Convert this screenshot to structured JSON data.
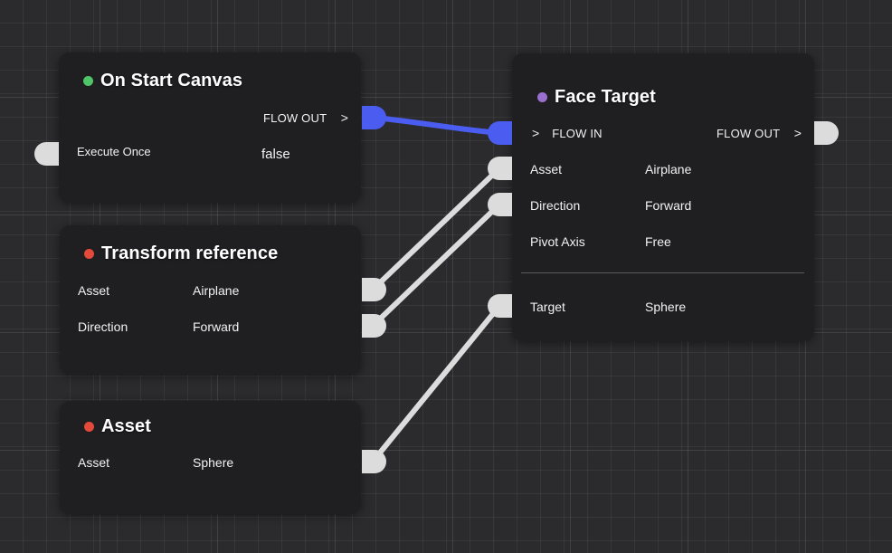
{
  "theme": {
    "background": "#2b2b2e",
    "node_background": "#1f1f22",
    "flow_wire_color": "#4a5df0",
    "data_wire_color": "#dcdcdc",
    "status_green": "#4fc56a",
    "status_red": "#e5493a",
    "status_purple": "#9b6fce"
  },
  "nodes": {
    "on_start_canvas": {
      "title": "On Start Canvas",
      "flow_out_label": "FLOW OUT",
      "chevron": ">",
      "execute_once_label": "Execute Once",
      "execute_once_value": "false"
    },
    "transform_reference": {
      "title": "Transform reference",
      "rows": [
        {
          "label": "Asset",
          "value": "Airplane"
        },
        {
          "label": "Direction",
          "value": "Forward"
        }
      ]
    },
    "asset": {
      "title": "Asset",
      "rows": [
        {
          "label": "Asset",
          "value": "Sphere"
        }
      ]
    },
    "face_target": {
      "title": "Face Target",
      "flow_in_label": "FLOW IN",
      "flow_out_label": "FLOW OUT",
      "chevron": ">",
      "rows": [
        {
          "label": "Asset",
          "value": "Airplane"
        },
        {
          "label": "Direction",
          "value": "Forward"
        },
        {
          "label": "Pivot Axis",
          "value": "Free"
        }
      ],
      "target_row": {
        "label": "Target",
        "value": "Sphere"
      }
    }
  },
  "icons": {
    "status_dot": "status-dot-icon",
    "chevron": "chevron-right-icon"
  }
}
